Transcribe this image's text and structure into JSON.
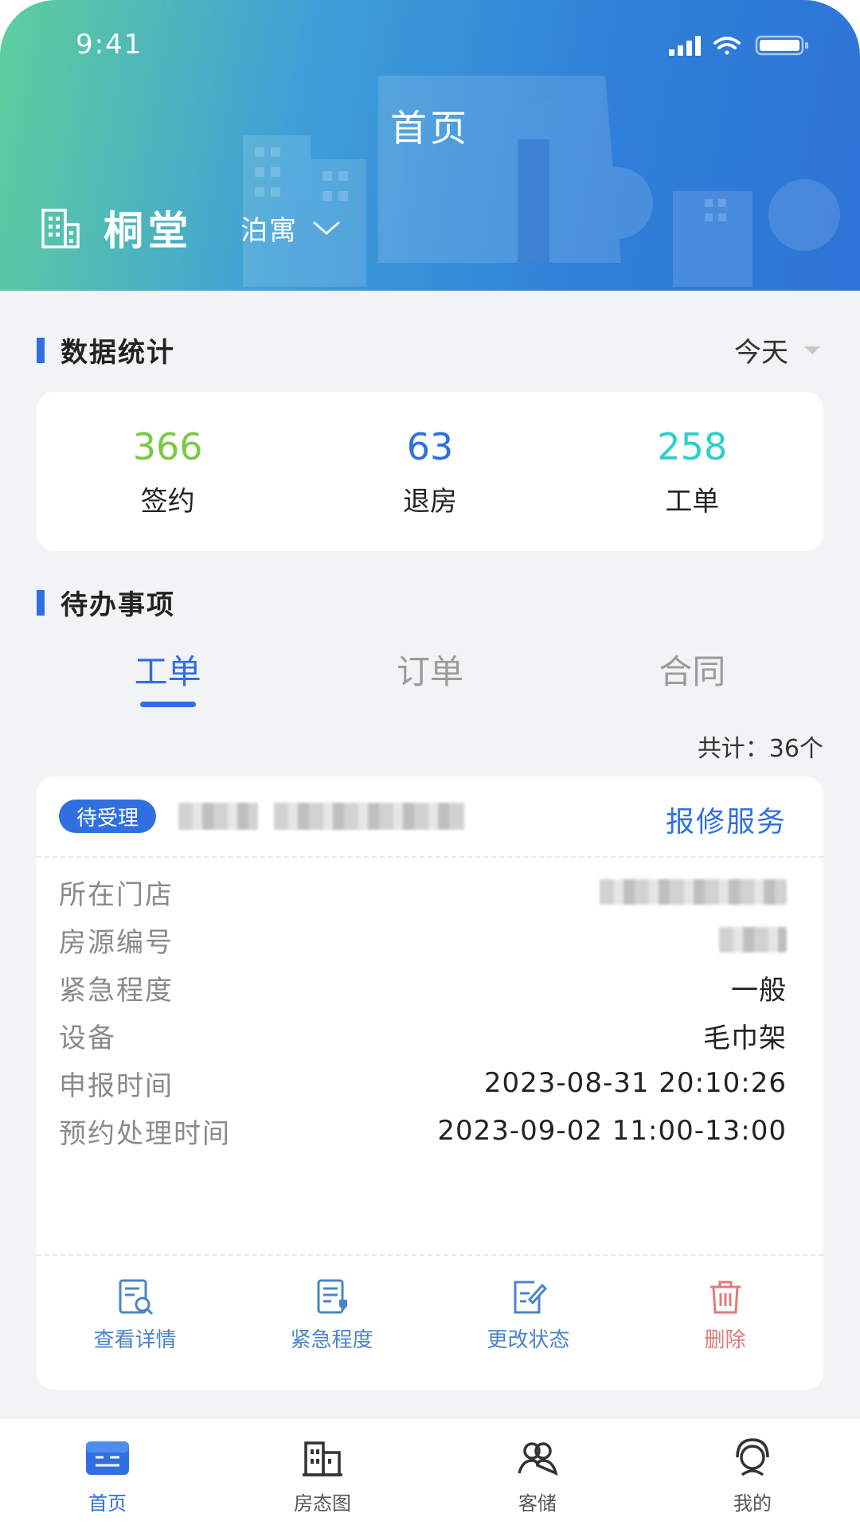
{
  "status_bar": {
    "time": "9:41"
  },
  "header": {
    "title": "首页",
    "location_name": "桐堂",
    "brand": "泊寓"
  },
  "stats": {
    "section_title": "数据统计",
    "period": "今天",
    "items": [
      {
        "value": "366",
        "label": "签约",
        "color": "#7ac943"
      },
      {
        "value": "63",
        "label": "退房",
        "color": "#2f6fe0"
      },
      {
        "value": "258",
        "label": "工单",
        "color": "#2bd1c9"
      }
    ]
  },
  "todo": {
    "section_title": "待办事项",
    "tabs": [
      {
        "label": "工单",
        "active": true
      },
      {
        "label": "订单",
        "active": false
      },
      {
        "label": "合同",
        "active": false
      }
    ],
    "total": "共计：36个"
  },
  "order": {
    "status": "待受理",
    "service_type": "报修服务",
    "fields": [
      {
        "label": "所在门店",
        "value": ""
      },
      {
        "label": "房源编号",
        "value": ""
      },
      {
        "label": "紧急程度",
        "value": "一般"
      },
      {
        "label": "设备",
        "value": "毛巾架"
      },
      {
        "label": "申报时间",
        "value": "2023-08-31 20:10:26"
      },
      {
        "label": "预约处理时间",
        "value": "2023-09-02 11:00-13:00"
      }
    ],
    "actions": [
      {
        "label": "查看详情",
        "icon": "view-detail-icon"
      },
      {
        "label": "紧急程度",
        "icon": "urgency-icon"
      },
      {
        "label": "更改状态",
        "icon": "edit-status-icon"
      },
      {
        "label": "删除",
        "icon": "trash-icon"
      }
    ]
  },
  "nav": {
    "items": [
      {
        "label": "首页",
        "icon": "home-icon",
        "active": true
      },
      {
        "label": "房态图",
        "icon": "buildings-icon",
        "active": false
      },
      {
        "label": "客储",
        "icon": "customers-icon",
        "active": false
      },
      {
        "label": "我的",
        "icon": "profile-icon",
        "active": false
      }
    ]
  },
  "colors": {
    "accent": "#2f6fe0",
    "delete": "#e07a7a"
  }
}
